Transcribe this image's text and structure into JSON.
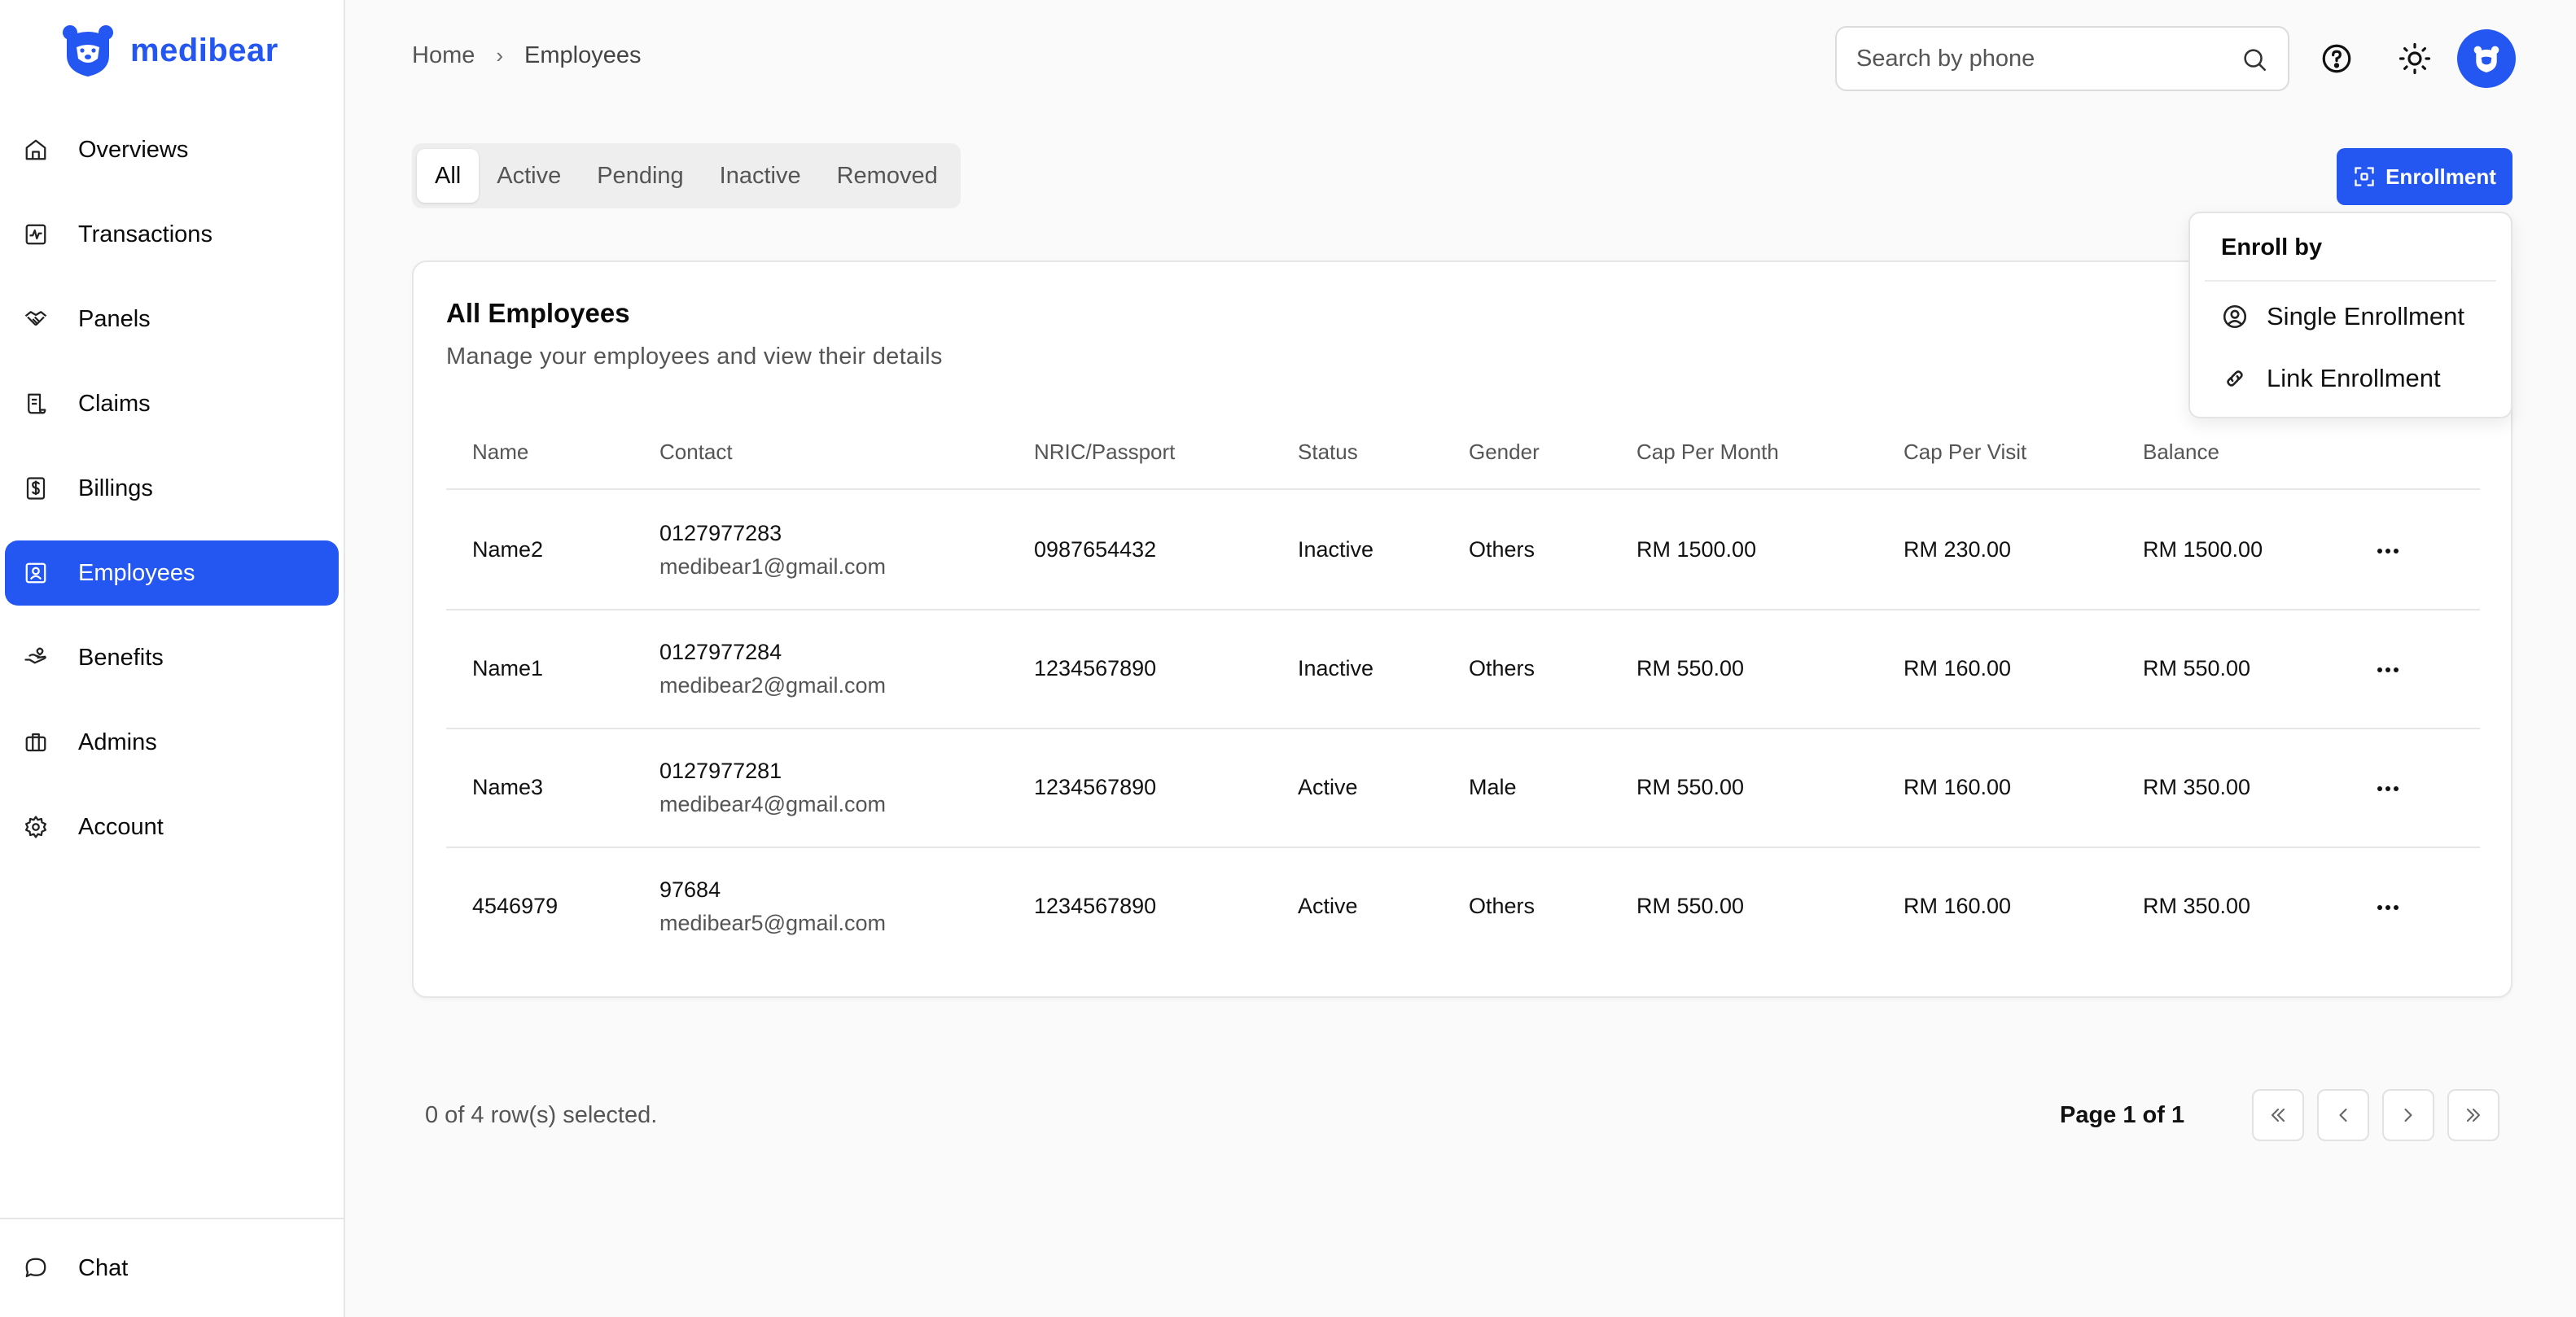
{
  "brand": {
    "name": "medibear",
    "accent": "#2456f2"
  },
  "sidebar": {
    "items": [
      {
        "label": "Overviews",
        "icon": "home-icon"
      },
      {
        "label": "Transactions",
        "icon": "transactions-icon"
      },
      {
        "label": "Panels",
        "icon": "handshake-icon"
      },
      {
        "label": "Claims",
        "icon": "receipt-icon"
      },
      {
        "label": "Billings",
        "icon": "billing-dollar-icon"
      },
      {
        "label": "Employees",
        "icon": "employee-badge-icon",
        "active": true
      },
      {
        "label": "Benefits",
        "icon": "benefits-hand-icon"
      },
      {
        "label": "Admins",
        "icon": "briefcase-icon"
      },
      {
        "label": "Account",
        "icon": "gear-icon"
      }
    ],
    "bottom": {
      "label": "Chat",
      "icon": "chat-bubble-icon"
    }
  },
  "header": {
    "breadcrumb": {
      "home": "Home",
      "current": "Employees"
    },
    "search": {
      "placeholder": "Search by phone",
      "value": ""
    }
  },
  "tabs": [
    "All",
    "Active",
    "Pending",
    "Inactive",
    "Removed"
  ],
  "active_tab": "All",
  "enrollment": {
    "button_label": "Enrollment",
    "menu_title": "Enroll by",
    "options": [
      "Single Enrollment",
      "Link Enrollment"
    ]
  },
  "table": {
    "title": "All Employees",
    "subtitle": "Manage your employees and view their details",
    "columns": [
      "Name",
      "Contact",
      "NRIC/Passport",
      "Status",
      "Gender",
      "Cap Per Month",
      "Cap Per Visit",
      "Balance"
    ],
    "rows": [
      {
        "name": "Name2",
        "phone": "0127977283",
        "email": "medibear1@gmail.com",
        "nric": "0987654432",
        "status": "Inactive",
        "gender": "Others",
        "cap_month": "RM 1500.00",
        "cap_visit": "RM 230.00",
        "balance": "RM 1500.00"
      },
      {
        "name": "Name1",
        "phone": "0127977284",
        "email": "medibear2@gmail.com",
        "nric": "1234567890",
        "status": "Inactive",
        "gender": "Others",
        "cap_month": "RM 550.00",
        "cap_visit": "RM 160.00",
        "balance": "RM 550.00"
      },
      {
        "name": "Name3",
        "phone": "0127977281",
        "email": "medibear4@gmail.com",
        "nric": "1234567890",
        "status": "Active",
        "gender": "Male",
        "cap_month": "RM 550.00",
        "cap_visit": "RM 160.00",
        "balance": "RM 350.00"
      },
      {
        "name": "4546979",
        "phone": "97684",
        "email": "medibear5@gmail.com",
        "nric": "1234567890",
        "status": "Active",
        "gender": "Others",
        "cap_month": "RM 550.00",
        "cap_visit": "RM 160.00",
        "balance": "RM 350.00"
      }
    ]
  },
  "footer": {
    "selected_text": "0 of 4 row(s) selected.",
    "page_text": "Page 1 of 1"
  }
}
